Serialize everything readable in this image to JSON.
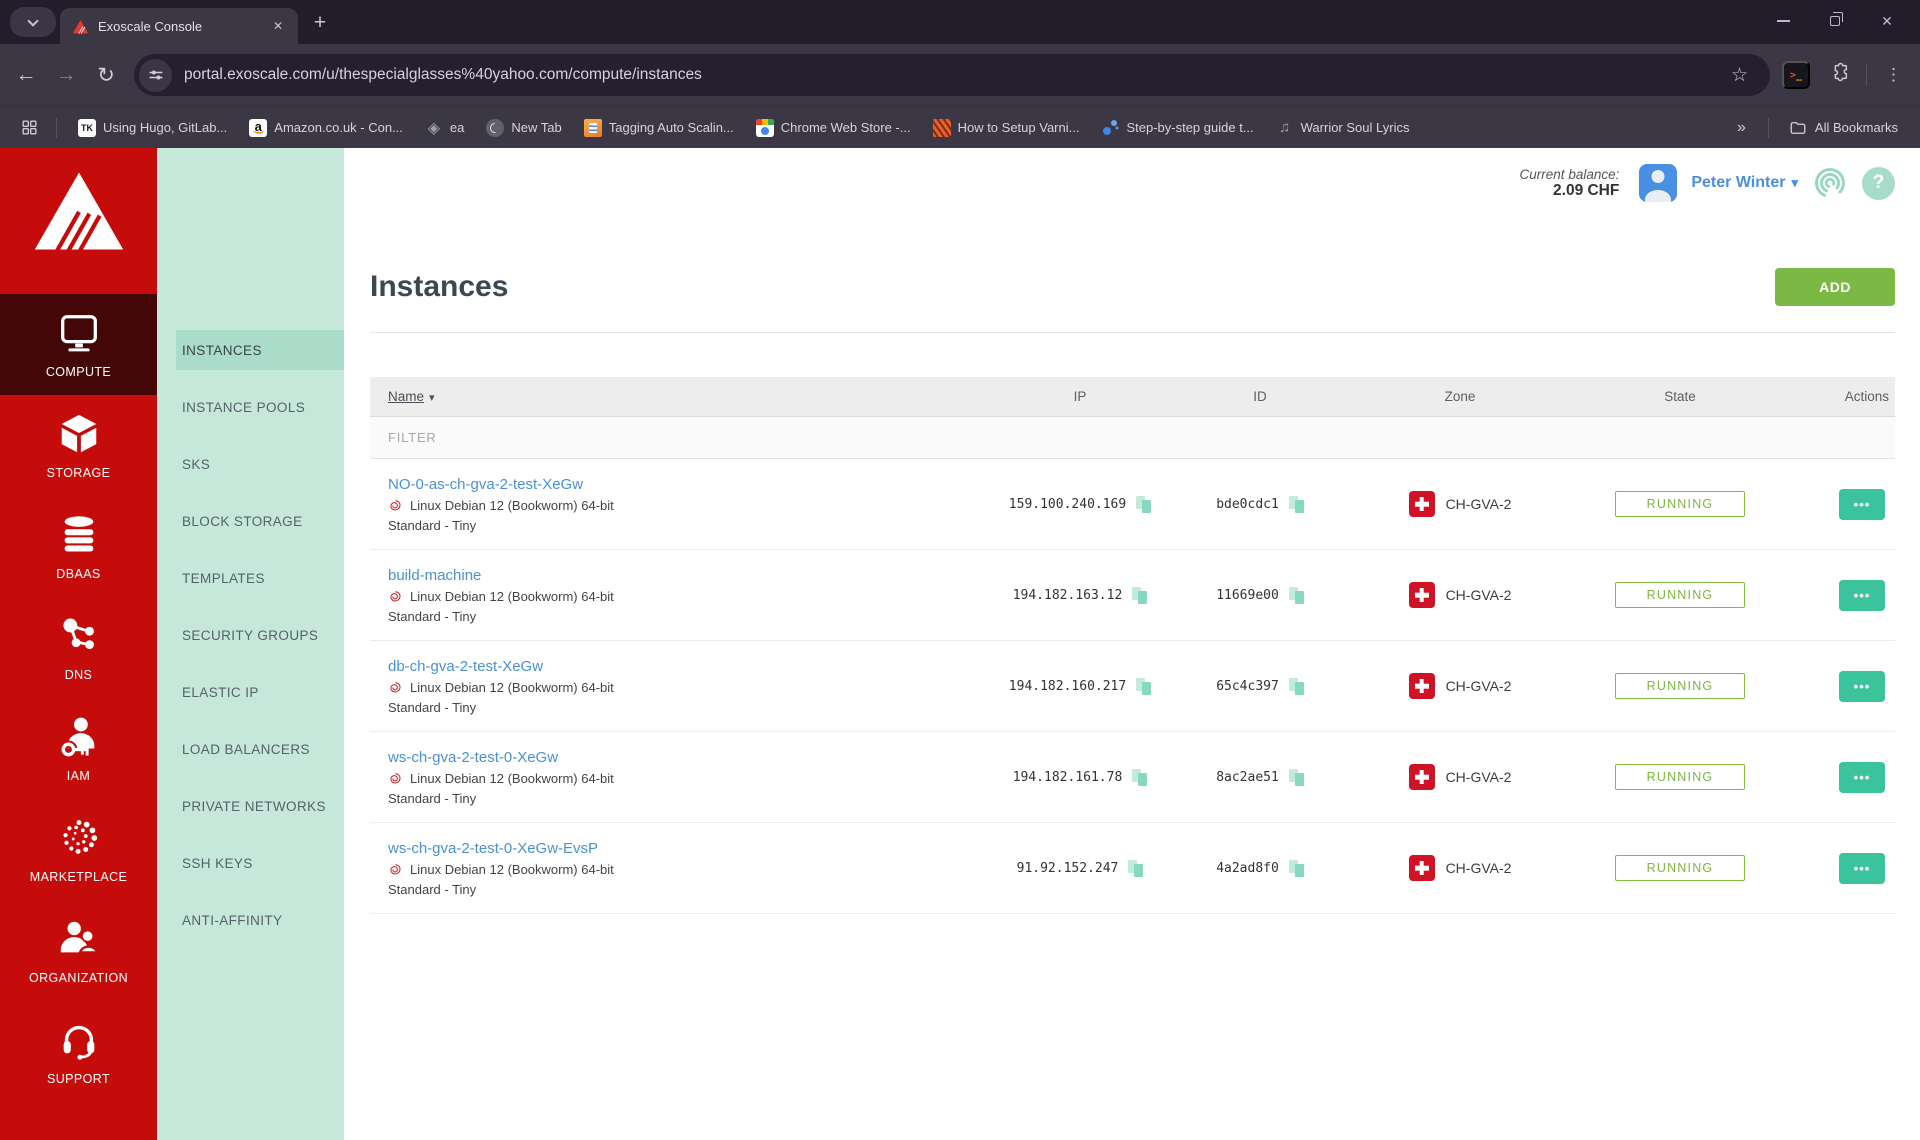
{
  "browser": {
    "tab_title": "Exoscale Console",
    "url": "portal.exoscale.com/u/thespecialglasses%40yahoo.com/compute/instances",
    "bookmarks": [
      {
        "label": "Using Hugo, GitLab...",
        "icon": "tk"
      },
      {
        "label": "Amazon.co.uk - Con...",
        "icon": "amazon"
      },
      {
        "label": "ea",
        "icon": "layers"
      },
      {
        "label": "New Tab",
        "icon": "globe"
      },
      {
        "label": "Tagging Auto Scalin...",
        "icon": "package"
      },
      {
        "label": "Chrome Web Store -...",
        "icon": "store"
      },
      {
        "label": "How to Setup Varni...",
        "icon": "flame"
      },
      {
        "label": "Step-by-step guide t...",
        "icon": "dots"
      },
      {
        "label": "Warrior Soul Lyrics",
        "icon": "music"
      }
    ],
    "all_bookmarks": "All Bookmarks"
  },
  "app": {
    "header": {
      "balance_label": "Current balance:",
      "balance_value": "2.09 CHF",
      "user_name": "Peter Winter"
    },
    "primary_nav": [
      {
        "label": "COMPUTE",
        "icon": "monitor",
        "active": true
      },
      {
        "label": "STORAGE",
        "icon": "cube",
        "active": false
      },
      {
        "label": "DBAAS",
        "icon": "db",
        "active": false
      },
      {
        "label": "DNS",
        "icon": "dns",
        "active": false
      },
      {
        "label": "IAM",
        "icon": "iam",
        "active": false
      },
      {
        "label": "MARKETPLACE",
        "icon": "marketplace",
        "active": false
      },
      {
        "label": "ORGANIZATION",
        "icon": "org",
        "active": false
      },
      {
        "label": "SUPPORT",
        "icon": "support",
        "active": false
      }
    ],
    "secondary_nav": [
      {
        "label": "INSTANCES",
        "active": true
      },
      {
        "label": "INSTANCE POOLS",
        "active": false
      },
      {
        "label": "SKS",
        "active": false
      },
      {
        "label": "BLOCK STORAGE",
        "active": false
      },
      {
        "label": "TEMPLATES",
        "active": false
      },
      {
        "label": "SECURITY GROUPS",
        "active": false
      },
      {
        "label": "ELASTIC IP",
        "active": false
      },
      {
        "label": "LOAD BALANCERS",
        "active": false
      },
      {
        "label": "PRIVATE NETWORKS",
        "active": false
      },
      {
        "label": "SSH KEYS",
        "active": false
      },
      {
        "label": "ANTI-AFFINITY",
        "active": false
      }
    ],
    "page": {
      "title": "Instances",
      "add_button": "ADD"
    },
    "table": {
      "headers": {
        "name": "Name",
        "ip": "IP",
        "id": "ID",
        "zone": "Zone",
        "state": "State",
        "actions": "Actions"
      },
      "filter_placeholder": "FILTER",
      "rows": [
        {
          "name": "NO-0-as-ch-gva-2-test-XeGw",
          "os": "Linux Debian 12 (Bookworm) 64-bit",
          "plan": "Standard - Tiny",
          "ip": "159.100.240.169",
          "id": "bde0cdc1",
          "zone": "CH-GVA-2",
          "state": "RUNNING"
        },
        {
          "name": "build-machine",
          "os": "Linux Debian 12 (Bookworm) 64-bit",
          "plan": "Standard - Tiny",
          "ip": "194.182.163.12",
          "id": "11669e00",
          "zone": "CH-GVA-2",
          "state": "RUNNING"
        },
        {
          "name": "db-ch-gva-2-test-XeGw",
          "os": "Linux Debian 12 (Bookworm) 64-bit",
          "plan": "Standard - Tiny",
          "ip": "194.182.160.217",
          "id": "65c4c397",
          "zone": "CH-GVA-2",
          "state": "RUNNING"
        },
        {
          "name": "ws-ch-gva-2-test-0-XeGw",
          "os": "Linux Debian 12 (Bookworm) 64-bit",
          "plan": "Standard - Tiny",
          "ip": "194.182.161.78",
          "id": "8ac2ae51",
          "zone": "CH-GVA-2",
          "state": "RUNNING"
        },
        {
          "name": "ws-ch-gva-2-test-0-XeGw-EvsP",
          "os": "Linux Debian 12 (Bookworm) 64-bit",
          "plan": "Standard - Tiny",
          "ip": "91.92.152.247",
          "id": "4a2ad8f0",
          "zone": "CH-GVA-2",
          "state": "RUNNING"
        }
      ]
    }
  },
  "colors": {
    "brand_red": "#c60b0b",
    "compute_active_dark": "#440707",
    "mint_sidebar": "#c5e8da",
    "mint_active": "#abdcc9",
    "add_green": "#7cb944",
    "running_green": "#82bb41",
    "actions_teal": "#3bc39c",
    "link_blue": "#4a90d9",
    "avatar_blue": "#4a90e2",
    "flag_red": "#cf1225"
  }
}
